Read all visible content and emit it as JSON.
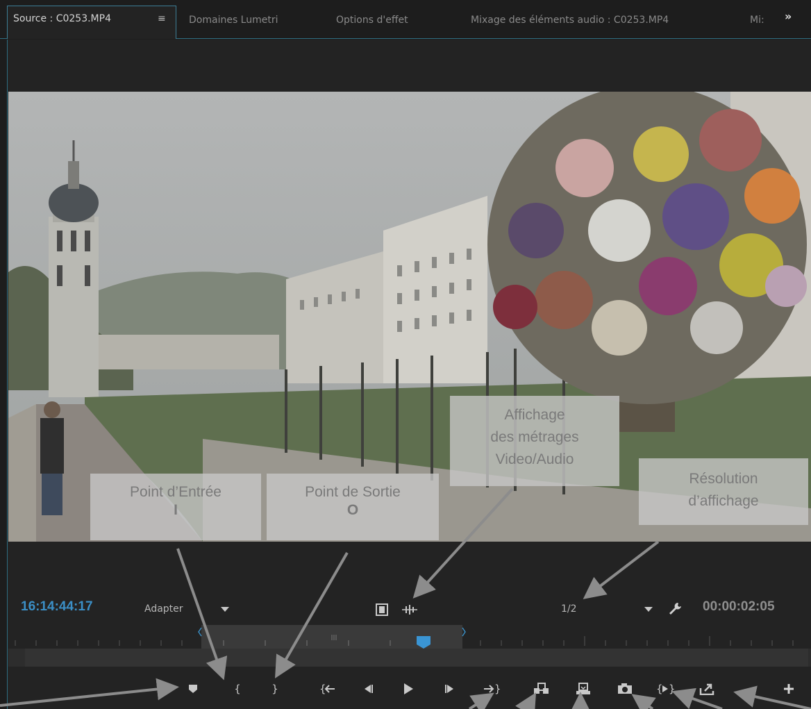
{
  "tabs": {
    "source": "Source : C0253.MP4",
    "lumetri": "Domaines Lumetri",
    "effect_options": "Options d'effet",
    "audio_mix": "Mixage des éléments audio : C0253.MP4",
    "truncated": "Mi:",
    "menu_icon": "hamburger-icon",
    "overflow_icon": "double-chevron-right-icon"
  },
  "monitor": {
    "current_timecode": "16:14:44:17",
    "zoom_value": "Adapter",
    "resolution_value": "1/2",
    "duration": "00:00:02:05"
  },
  "controls": [
    "marker-icon",
    "mark-in-icon",
    "mark-out-icon",
    "go-to-in-icon",
    "step-back-icon",
    "play-icon",
    "step-forward-icon",
    "go-to-out-icon",
    "insert-icon",
    "overwrite-icon",
    "export-frame-icon",
    "play-in-to-out-icon",
    "button-editor-icon",
    "add-button-icon"
  ],
  "annotations": {
    "in_point_title": "Point d’Entrée",
    "in_point_key": "I",
    "out_point_title": "Point de Sortie",
    "out_point_key": "O",
    "display_line1": "Affichage",
    "display_line2": "des métrages",
    "display_line3": "Video/Audio",
    "resolution_line1": "Résolution",
    "resolution_line2": "d’affichage"
  },
  "colors": {
    "timecode_blue": "#3b8fc6",
    "panel_border": "#2f6f82",
    "playhead": "#3a95d4"
  }
}
